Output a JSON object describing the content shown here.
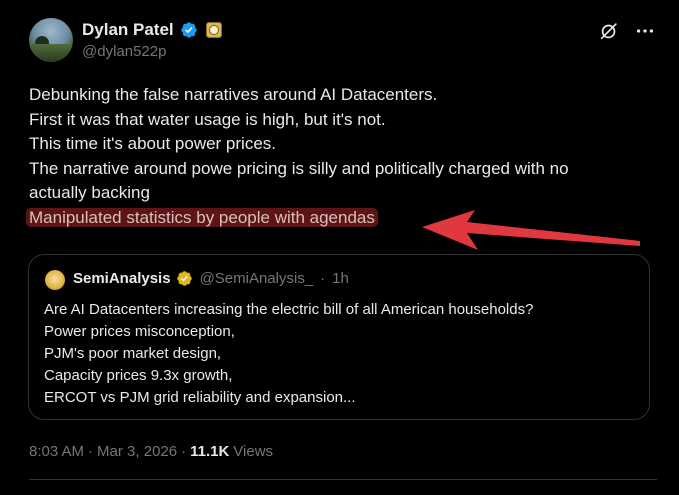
{
  "author": {
    "display_name": "Dylan Patel",
    "handle": "@dylan522p",
    "verified_badge": "blue-verified-icon",
    "affiliate_badge": "semianalysis-affiliate-icon"
  },
  "tweet": {
    "lines": [
      "Debunking the false narratives around AI Datacenters.",
      "First it was that water usage is high, but it's not.",
      "This time it's about power prices.",
      "The narrative around powe pricing is silly and politically charged with no",
      "actually backing"
    ],
    "highlighted_line": "Manipulated statistics by people with agendas",
    "highlight_color": "#5c1416",
    "annotation_arrow_color": "#e0383e"
  },
  "quote": {
    "display_name": "SemiAnalysis",
    "handle": "@SemiAnalysis_",
    "time": "1h",
    "separator": "·",
    "badge": "gold-verified-icon",
    "lines": [
      "Are AI Datacenters increasing the electric bill of all American households?",
      "Power prices misconception,",
      "PJM's poor market design,",
      "Capacity prices 9.3x growth,",
      "ERCOT vs PJM grid reliability and expansion..."
    ]
  },
  "meta": {
    "time": "8:03 AM",
    "separator": "·",
    "date": "Mar 3, 2026",
    "separator2": "·",
    "views_count": "11.1K",
    "views_label": "Views"
  },
  "colors": {
    "background": "#000000",
    "text": "#e7e9ea",
    "muted": "#71767b",
    "verified_blue": "#1d9bf0",
    "gold": "#e2b719",
    "border": "#2f3336"
  }
}
